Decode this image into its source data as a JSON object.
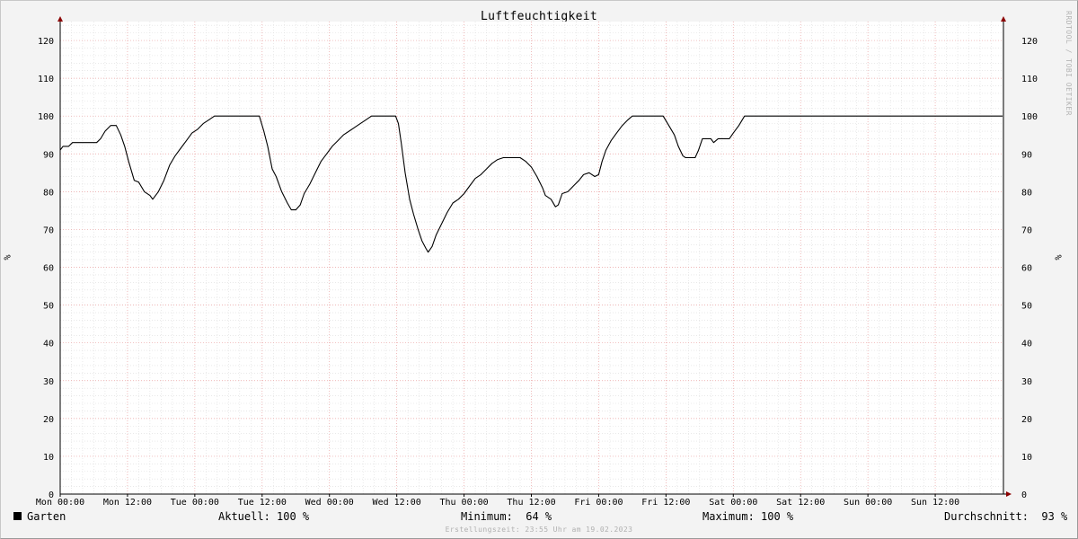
{
  "chart_data": {
    "type": "line",
    "title": "Luftfeuchtigkeit",
    "ylabel": "%",
    "ylim": [
      0,
      125
    ],
    "yticks": [
      0,
      10,
      20,
      30,
      40,
      50,
      60,
      70,
      80,
      90,
      100,
      110,
      120
    ],
    "xlim_hours": [
      0,
      168
    ],
    "xticks": [
      {
        "hour": 0,
        "label": "Mon 00:00"
      },
      {
        "hour": 12,
        "label": "Mon 12:00"
      },
      {
        "hour": 24,
        "label": "Tue 00:00"
      },
      {
        "hour": 36,
        "label": "Tue 12:00"
      },
      {
        "hour": 48,
        "label": "Wed 00:00"
      },
      {
        "hour": 60,
        "label": "Wed 12:00"
      },
      {
        "hour": 72,
        "label": "Thu 00:00"
      },
      {
        "hour": 84,
        "label": "Thu 12:00"
      },
      {
        "hour": 96,
        "label": "Fri 00:00"
      },
      {
        "hour": 108,
        "label": "Fri 12:00"
      },
      {
        "hour": 120,
        "label": "Sat 00:00"
      },
      {
        "hour": 132,
        "label": "Sat 12:00"
      },
      {
        "hour": 144,
        "label": "Sun 00:00"
      },
      {
        "hour": 156,
        "label": "Sun 12:00"
      }
    ],
    "grid": true,
    "series": [
      {
        "name": "Garten",
        "color": "#000000",
        "points": [
          [
            0,
            91
          ],
          [
            0.5,
            92
          ],
          [
            1.5,
            92
          ],
          [
            2.2,
            93
          ],
          [
            6.5,
            93
          ],
          [
            7.2,
            94
          ],
          [
            8,
            96
          ],
          [
            9,
            97.5
          ],
          [
            10,
            97.5
          ],
          [
            10.8,
            95
          ],
          [
            11.5,
            92
          ],
          [
            12.2,
            88
          ],
          [
            13.2,
            83
          ],
          [
            14,
            82.5
          ],
          [
            15,
            80
          ],
          [
            16,
            79
          ],
          [
            16.5,
            78
          ],
          [
            17.5,
            80
          ],
          [
            18.5,
            83
          ],
          [
            19.5,
            87
          ],
          [
            20.5,
            89.5
          ],
          [
            21.5,
            91.5
          ],
          [
            22.5,
            93.5
          ],
          [
            23.5,
            95.5
          ],
          [
            24.5,
            96.5
          ],
          [
            25.5,
            98
          ],
          [
            26.5,
            99
          ],
          [
            27.5,
            100
          ],
          [
            35.5,
            100
          ],
          [
            36.3,
            96
          ],
          [
            37,
            92
          ],
          [
            37.8,
            86
          ],
          [
            38.5,
            84
          ],
          [
            39.5,
            80
          ],
          [
            40.5,
            77
          ],
          [
            41.2,
            75.2
          ],
          [
            42,
            75.2
          ],
          [
            42.8,
            76.5
          ],
          [
            43.5,
            79.5
          ],
          [
            44.5,
            82
          ],
          [
            45.5,
            85
          ],
          [
            46.5,
            88
          ],
          [
            47.5,
            90
          ],
          [
            48.5,
            92
          ],
          [
            49.5,
            93.5
          ],
          [
            50.5,
            95
          ],
          [
            51.5,
            96
          ],
          [
            52.5,
            97
          ],
          [
            53.5,
            98
          ],
          [
            54.5,
            99
          ],
          [
            55.5,
            100
          ],
          [
            59.8,
            100
          ],
          [
            60.3,
            98
          ],
          [
            60.8,
            93
          ],
          [
            61.5,
            85
          ],
          [
            62.3,
            78
          ],
          [
            63,
            74
          ],
          [
            63.8,
            70
          ],
          [
            64.5,
            67
          ],
          [
            65.2,
            65
          ],
          [
            65.6,
            64
          ],
          [
            66.3,
            65.5
          ],
          [
            67,
            68.5
          ],
          [
            68,
            71.5
          ],
          [
            69,
            74.5
          ],
          [
            70,
            77
          ],
          [
            71,
            78
          ],
          [
            72,
            79.5
          ],
          [
            73,
            81.5
          ],
          [
            74,
            83.5
          ],
          [
            75,
            84.5
          ],
          [
            76,
            86
          ],
          [
            77,
            87.5
          ],
          [
            78,
            88.5
          ],
          [
            79,
            89
          ],
          [
            82,
            89
          ],
          [
            83,
            88
          ],
          [
            84,
            86.5
          ],
          [
            85,
            84
          ],
          [
            86,
            81
          ],
          [
            86.5,
            79
          ],
          [
            87.5,
            78
          ],
          [
            88.3,
            76
          ],
          [
            88.8,
            76.5
          ],
          [
            89.5,
            79.5
          ],
          [
            90.5,
            80
          ],
          [
            91.5,
            81.5
          ],
          [
            92.5,
            83
          ],
          [
            93.3,
            84.5
          ],
          [
            94.3,
            85
          ],
          [
            95.3,
            84
          ],
          [
            96,
            84.5
          ],
          [
            96.6,
            88
          ],
          [
            97.3,
            91
          ],
          [
            98.2,
            93.5
          ],
          [
            99.2,
            95.5
          ],
          [
            100.2,
            97.5
          ],
          [
            101.2,
            99
          ],
          [
            102,
            100
          ],
          [
            107.5,
            100
          ],
          [
            108.5,
            97.5
          ],
          [
            109.5,
            95
          ],
          [
            110.2,
            92
          ],
          [
            111,
            89.5
          ],
          [
            111.5,
            89
          ],
          [
            113.2,
            89
          ],
          [
            113.8,
            91
          ],
          [
            114.5,
            94
          ],
          [
            116,
            94
          ],
          [
            116.5,
            93
          ],
          [
            117.3,
            94
          ],
          [
            119.3,
            94
          ],
          [
            120,
            95.5
          ],
          [
            121,
            97.5
          ],
          [
            122,
            100
          ],
          [
            168,
            100
          ]
        ]
      }
    ]
  },
  "legend": {
    "series_name": "Garten",
    "aktuell": "Aktuell: 100 %",
    "minimum": "Minimum:  64 %",
    "maximum": "Maximum: 100 %",
    "durchschnitt": "Durchschnitt:  93 %"
  },
  "watermark": "RRDTOOL / TOBI OETIKER",
  "footer": "Erstellungszeit: 23:55 Uhr am 19.02.2023"
}
